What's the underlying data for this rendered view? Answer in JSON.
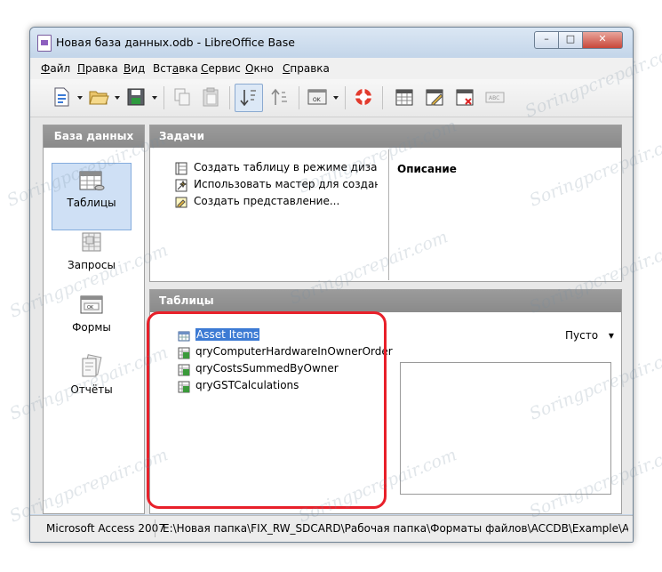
{
  "window": {
    "title": "Новая база данных.odb - LibreOffice Base",
    "controls": {
      "minimize": "–",
      "maximize": "□",
      "close": "✕"
    }
  },
  "menu": [
    {
      "pre": "",
      "key": "Ф",
      "rest": "айл"
    },
    {
      "pre": "",
      "key": "П",
      "rest": "равка"
    },
    {
      "pre": "",
      "key": "В",
      "rest": "ид"
    },
    {
      "pre": "Вст",
      "key": "а",
      "rest": "вка"
    },
    {
      "pre": "",
      "key": "С",
      "rest": "ервис"
    },
    {
      "pre": "",
      "key": "О",
      "rest": "кно"
    },
    {
      "pre": "",
      "key": "С",
      "rest": "правка"
    }
  ],
  "toolbar": {
    "icons": [
      "new-document-icon",
      "open-folder-icon",
      "save-icon",
      "copy-icon",
      "paste-icon",
      "sort-descending-icon",
      "sort-ascending-icon",
      "form-ok-icon",
      "help-lifebuoy-icon",
      "open-object-icon",
      "edit-object-icon",
      "delete-object-icon",
      "rename-object-icon"
    ]
  },
  "left_panel": {
    "title": "База данных",
    "items": [
      {
        "label": "Таблицы",
        "icon": "tables-icon",
        "selected": true
      },
      {
        "label": "Запросы",
        "icon": "queries-icon",
        "selected": false
      },
      {
        "label": "Формы",
        "icon": "forms-icon",
        "selected": false
      },
      {
        "label": "Отчёты",
        "icon": "reports-icon",
        "selected": false
      }
    ]
  },
  "tasks_panel": {
    "title": "Задачи",
    "tasks": [
      "Создать таблицу в режиме дизайна...",
      "Использовать мастер для создания таблицы...",
      "Создать представление..."
    ],
    "description_title": "Описание"
  },
  "tables_panel": {
    "title": "Таблицы",
    "items": [
      {
        "name": "Asset Items",
        "selected": true
      },
      {
        "name": "qryComputerHardwareInOwnerOrder",
        "selected": false
      },
      {
        "name": "qryCostsSummedByOwner",
        "selected": false
      },
      {
        "name": "qryGSTCalculations",
        "selected": false
      }
    ],
    "preview_mode": "Пусто",
    "preview_arrow": "▾"
  },
  "status_bar": {
    "format": "Microsoft Access 2007",
    "path": "E:\\Новая папка\\FIX_RW_SDCARD\\Рабочая папка\\Форматы файлов\\ACCDB\\Example\\ASampleData"
  },
  "colors": {
    "panel_header": "#8f8f8f",
    "selection": "#3d7bd4",
    "annotation_frame": "#e8202a"
  },
  "watermark": "Soringpcrepair.com"
}
